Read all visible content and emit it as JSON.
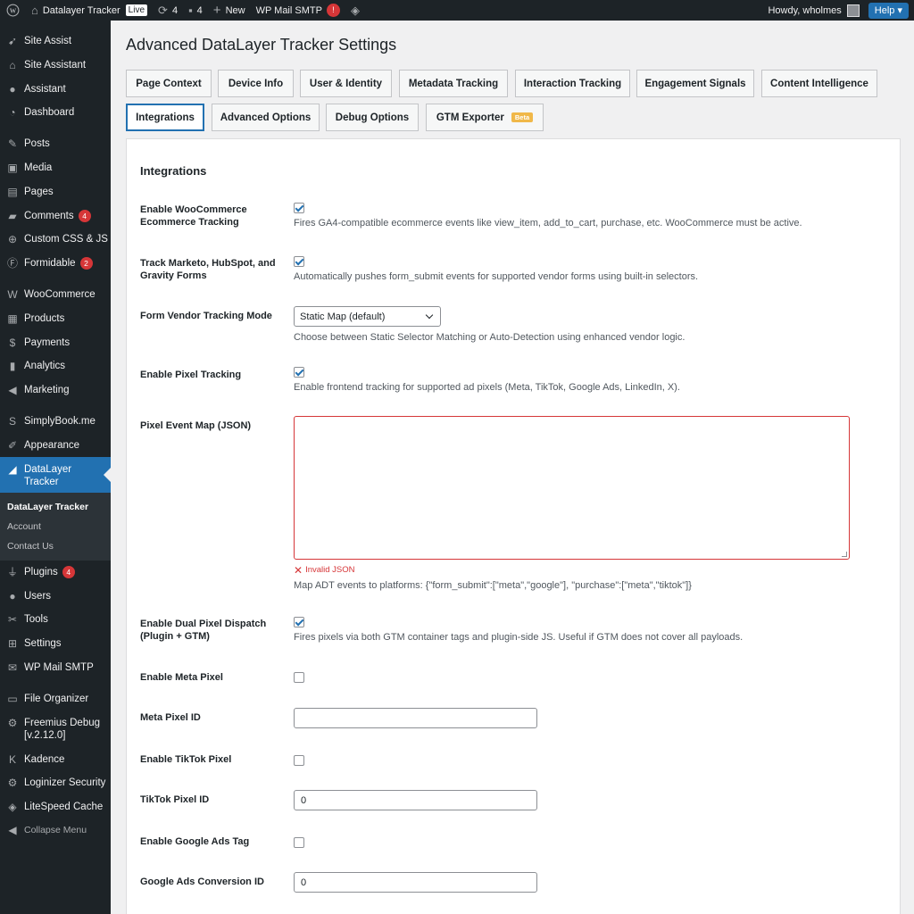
{
  "admin_bar": {
    "site_name": "Datalayer Tracker",
    "live_badge": "Live",
    "updates_count": "4",
    "comments_count": "4",
    "new_label": "New",
    "smtp_label": "WP Mail SMTP",
    "smtp_badge": "!",
    "greeting": "Howdy, wholmes",
    "help_label": "Help"
  },
  "sidebar": {
    "items": [
      {
        "label": "Site Assist",
        "icon": "rocket-icon"
      },
      {
        "label": "Site Assistant",
        "icon": "home-icon"
      },
      {
        "label": "Assistant",
        "icon": "user-icon"
      },
      {
        "label": "Dashboard",
        "icon": "dashboard-icon"
      },
      {
        "label": "Posts",
        "icon": "pin-icon"
      },
      {
        "label": "Media",
        "icon": "media-icon"
      },
      {
        "label": "Pages",
        "icon": "pages-icon"
      },
      {
        "label": "Comments",
        "icon": "comment-icon",
        "badge": "4"
      },
      {
        "label": "Custom CSS & JS",
        "icon": "plus-icon"
      },
      {
        "label": "Formidable",
        "icon": "formidable-icon",
        "badge": "2"
      },
      {
        "label": "WooCommerce",
        "icon": "woo-icon"
      },
      {
        "label": "Products",
        "icon": "archive-icon"
      },
      {
        "label": "Payments",
        "icon": "dollar-icon"
      },
      {
        "label": "Analytics",
        "icon": "bar-chart-icon"
      },
      {
        "label": "Marketing",
        "icon": "megaphone-icon"
      },
      {
        "label": "SimplyBook.me",
        "icon": "s-icon"
      },
      {
        "label": "Appearance",
        "icon": "brush-icon"
      },
      {
        "label": "DataLayer Tracker",
        "icon": "chart-icon"
      },
      {
        "label": "Plugins",
        "icon": "plug-icon",
        "badge": "4"
      },
      {
        "label": "Users",
        "icon": "users-icon"
      },
      {
        "label": "Tools",
        "icon": "wrench-icon"
      },
      {
        "label": "Settings",
        "icon": "settings-icon"
      },
      {
        "label": "WP Mail SMTP",
        "icon": "mail-icon"
      },
      {
        "label": "File Organizer",
        "icon": "folder-icon"
      },
      {
        "label": "Freemius Debug [v.2.12.0]",
        "icon": "gear-icon"
      },
      {
        "label": "Kadence",
        "icon": "kadence-icon"
      },
      {
        "label": "Loginizer Security",
        "icon": "gear-icon"
      },
      {
        "label": "LiteSpeed Cache",
        "icon": "diamond-icon"
      }
    ],
    "submenu": [
      "DataLayer Tracker",
      "Account",
      "Contact Us"
    ],
    "collapse_label": "Collapse Menu"
  },
  "page": {
    "title": "Advanced DataLayer Tracker Settings",
    "tabs": [
      "Page Context",
      "Device Info",
      "User & Identity",
      "Metadata Tracking",
      "Interaction Tracking",
      "Engagement Signals",
      "Content Intelligence",
      "Integrations",
      "Advanced Options",
      "Debug Options",
      "GTM Exporter"
    ],
    "beta_label": "Beta",
    "section_title": "Integrations"
  },
  "fields": {
    "woo_label": "Enable WooCommerce Ecommerce Tracking",
    "woo_desc": "Fires GA4-compatible ecommerce events like view_item, add_to_cart, purchase, etc. WooCommerce must be active.",
    "woo_checked": true,
    "forms_label": "Track Marketo, HubSpot, and Gravity Forms",
    "forms_desc": "Automatically pushes form_submit events for supported vendor forms using built-in selectors.",
    "forms_checked": true,
    "mode_label": "Form Vendor Tracking Mode",
    "mode_value": "Static Map (default)",
    "mode_desc": "Choose between Static Selector Matching or Auto-Detection using enhanced vendor logic.",
    "pixel_label": "Enable Pixel Tracking",
    "pixel_desc": "Enable frontend tracking for supported ad pixels (Meta, TikTok, Google Ads, LinkedIn, X).",
    "pixel_checked": true,
    "map_label": "Pixel Event Map (JSON)",
    "map_value": "",
    "map_error": "Invalid JSON",
    "map_desc": "Map ADT events to platforms: {\"form_submit\":[\"meta\",\"google\"], \"purchase\":[\"meta\",\"tiktok\"]}",
    "dual_label": "Enable Dual Pixel Dispatch (Plugin + GTM)",
    "dual_desc": "Fires pixels via both GTM container tags and plugin-side JS. Useful if GTM does not cover all payloads.",
    "dual_checked": true,
    "meta_label": "Enable Meta Pixel",
    "meta_checked": false,
    "meta_id_label": "Meta Pixel ID",
    "meta_id_value": "",
    "tiktok_label": "Enable TikTok Pixel",
    "tiktok_checked": false,
    "tiktok_id_label": "TikTok Pixel ID",
    "tiktok_id_value": "0",
    "gads_label": "Enable Google Ads Tag",
    "gads_checked": false,
    "gads_id_label": "Google Ads Conversion ID",
    "gads_id_value": "0"
  }
}
